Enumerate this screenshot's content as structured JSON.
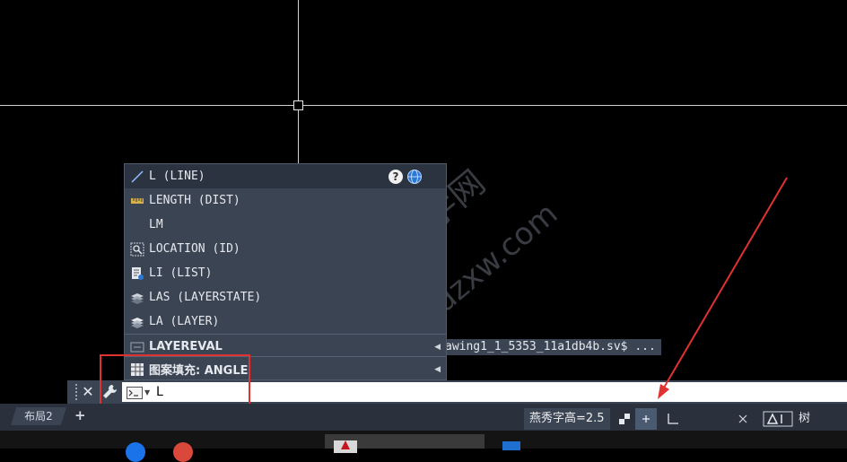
{
  "watermark": {
    "line1": "CAD自学网",
    "line2": "www.cadzxw.com"
  },
  "autocomplete": {
    "items": [
      {
        "label": "L (LINE)",
        "icon": "line-icon"
      },
      {
        "label": "LENGTH (DIST)",
        "icon": "ruler-icon"
      },
      {
        "label": "LM",
        "icon": ""
      },
      {
        "label": "LOCATION (ID)",
        "icon": "locate-point-icon"
      },
      {
        "label": "LI (LIST)",
        "icon": "list-icon"
      },
      {
        "label": "LAS (LAYERSTATE)",
        "icon": "layer-state-icon"
      },
      {
        "label": "LA (LAYER)",
        "icon": "layer-icon"
      },
      {
        "label": "LAYEREVAL",
        "icon": "layer-eval-icon",
        "submenu": true
      },
      {
        "label": "图案填充: ANGLE",
        "icon": "hatch-icon",
        "submenu": true
      }
    ],
    "help_glyph": "?"
  },
  "file_path_fragment": "awing1_1_5353_11a1db4b.sv$ ...",
  "command_line": {
    "close_glyph": "✕",
    "input_value": "L"
  },
  "status_bar": {
    "layout_tab": "布局2",
    "add_tab_glyph": "+",
    "annotation_scale": "燕秀字高=2.5",
    "tree_label": "树"
  },
  "colors": {
    "canvas": "#000000",
    "panel": "#3b4453",
    "highlight_row": "#2c3340",
    "red_annotation": "#e13232"
  }
}
